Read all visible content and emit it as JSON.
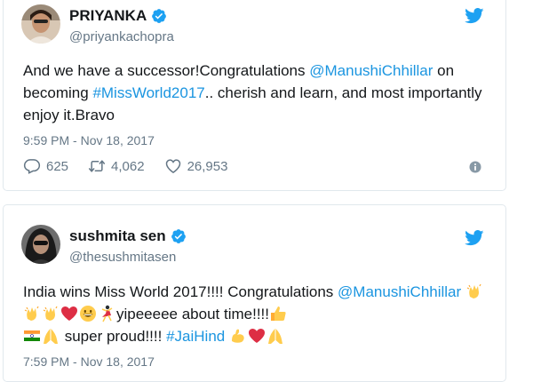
{
  "tweets": [
    {
      "name": "PRIYANKA",
      "handle": "@priyankachopra",
      "text_parts": {
        "a": "And we have a successor!Congratulations ",
        "mention": "@ManushiChhillar",
        "b": " on becoming ",
        "hashtag": "#MissWorld2017",
        "c": ".. cherish and learn, and most importantly enjoy it.Bravo"
      },
      "timestamp": "9:59 PM - Nov 18, 2017",
      "replies": "625",
      "retweets": "4,062",
      "likes": "26,953"
    },
    {
      "name": "sushmita sen",
      "handle": "@thesushmitasen",
      "text_parts": {
        "a": "India wins Miss World 2017!!!! Congratulations ",
        "mention": "@ManushiChhillar",
        "b": "yipeeeee about time!!!!",
        "c": " super proud!!!! ",
        "hashtag": "#JaiHind"
      },
      "timestamp": "7:59 PM - Nov 18, 2017"
    }
  ],
  "icons": {
    "verified": "verified-badge-icon",
    "twitter": "twitter-bird-icon",
    "reply": "reply-icon",
    "retweet": "retweet-icon",
    "like": "heart-icon",
    "info": "info-icon"
  },
  "colors": {
    "link": "#1b95e0",
    "muted": "#657786",
    "text": "#14171a"
  }
}
